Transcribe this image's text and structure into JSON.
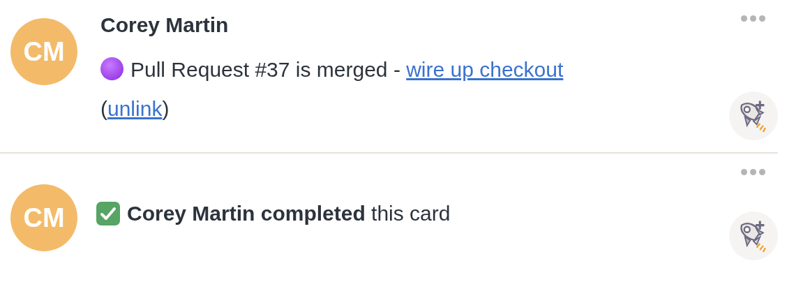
{
  "activities": [
    {
      "kind": "comment",
      "avatar": "CM",
      "author": "Corey Martin",
      "text": "Pull Request #37 is merged - ",
      "link": "wire up checkout",
      "open": "(",
      "link2": "unlink",
      "close": ")"
    },
    {
      "kind": "event",
      "avatar": "CM",
      "text": "**Corey Martin completed** this card"
    }
  ]
}
